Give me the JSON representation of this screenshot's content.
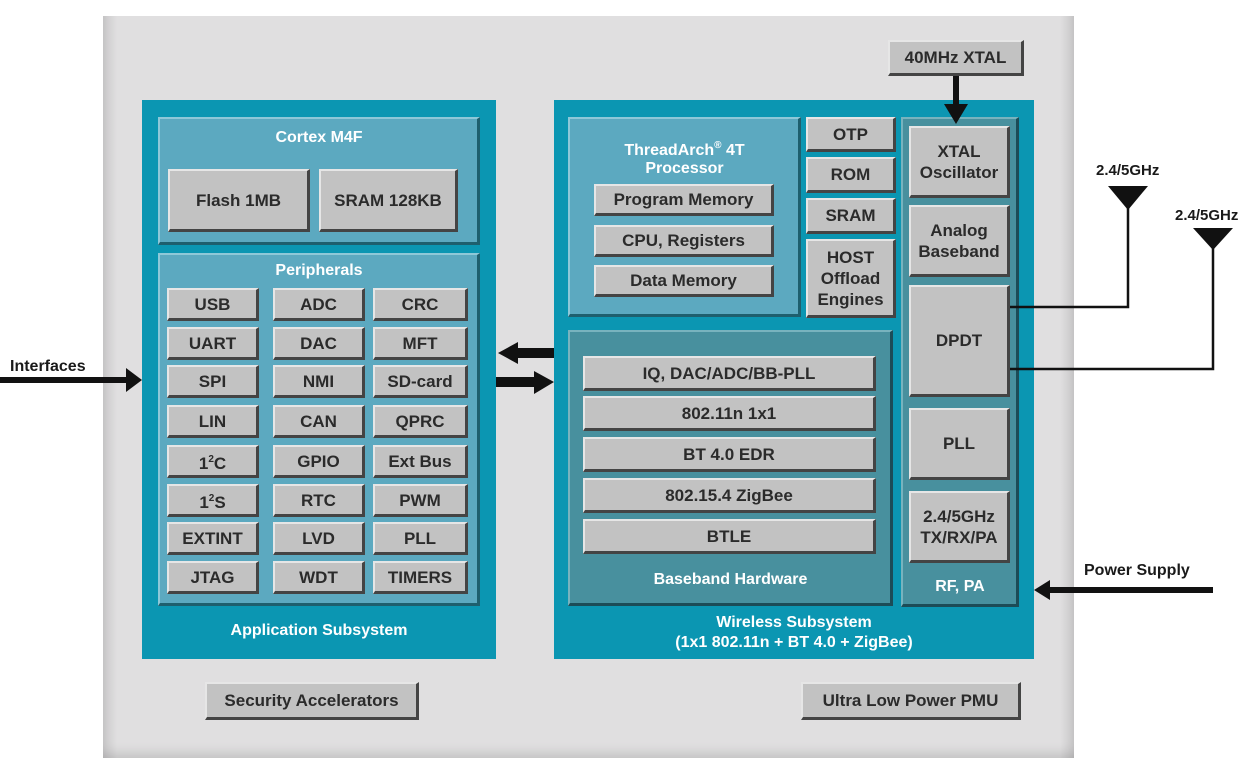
{
  "external": {
    "xtal": "40MHz XTAL",
    "interfaces": "Interfaces",
    "power_supply": "Power Supply",
    "antenna_1": "2.4/5GHz",
    "antenna_2": "2.4/5GHz"
  },
  "application_subsystem": {
    "title": "Application Subsystem",
    "cortex": {
      "title": "Cortex M4F",
      "flash": "Flash 1MB",
      "sram": "SRAM 128KB"
    },
    "peripherals": {
      "title": "Peripherals",
      "items": [
        "USB",
        "ADC",
        "CRC",
        "UART",
        "DAC",
        "MFT",
        "SPI",
        "NMI",
        "SD-card",
        "LIN",
        "CAN",
        "QPRC",
        "I2C",
        "GPIO",
        "Ext Bus",
        "I2S",
        "RTC",
        "PWM",
        "EXTINT",
        "LVD",
        "PLL",
        "JTAG",
        "WDT",
        "TIMERS"
      ],
      "i2c_base": "1",
      "i2c_sup": "2",
      "i2c_suffix": "C",
      "i2s_base": "1",
      "i2s_sup": "2",
      "i2s_suffix": "S"
    }
  },
  "wireless_subsystem": {
    "title_line1": "Wireless Subsystem",
    "title_line2": "(1x1 802.11n + BT 4.0 + ZigBee)",
    "processor": {
      "title_line1": "ThreadArch",
      "title_reg": "®",
      "title_suffix": " 4T",
      "title_line2": "Processor",
      "items": [
        "Program Memory",
        "CPU, Registers",
        "Data Memory"
      ]
    },
    "memory": {
      "otp": "OTP",
      "rom": "ROM",
      "sram": "SRAM",
      "host_line1": "HOST",
      "host_line2": "Offload",
      "host_line3": "Engines"
    },
    "baseband": {
      "title": "Baseband Hardware",
      "items": [
        "IQ, DAC/ADC/BB-PLL",
        "802.11n 1x1",
        "BT 4.0 EDR",
        "802.15.4 ZigBee",
        "BTLE"
      ]
    },
    "rf": {
      "title": "RF, PA",
      "xtal_osc_line1": "XTAL",
      "xtal_osc_line2": "Oscillator",
      "analog_line1": "Analog",
      "analog_line2": "Baseband",
      "dpdt": "DPDT",
      "pll": "PLL",
      "txrx_line1": "2.4/5GHz",
      "txrx_line2": "TX/RX/PA"
    }
  },
  "chip_blocks": {
    "security": "Security Accelerators",
    "pmu": "Ultra Low Power PMU"
  }
}
